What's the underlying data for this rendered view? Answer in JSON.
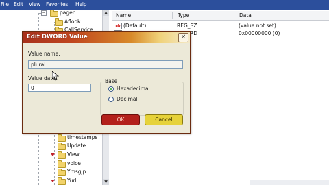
{
  "menubar": {
    "items": [
      "File",
      "Edit",
      "View",
      "Favorites",
      "Help"
    ]
  },
  "tree": {
    "items_top": [
      "pager",
      "Aflook",
      "CallService"
    ],
    "items_bottom": [
      "timestamps",
      "Update",
      "View",
      "voice",
      "Ymsgjp",
      "Yurl"
    ]
  },
  "list": {
    "headers": {
      "name": "Name",
      "type": "Type",
      "data": "Data"
    },
    "rows": [
      {
        "icon": "ab",
        "name": "(Default)",
        "type": "REG_SZ",
        "data": "(value not set)"
      },
      {
        "icon": "dword",
        "name": "",
        "type": "DWORD",
        "data": "0x00000000 (0)"
      }
    ]
  },
  "dialog": {
    "title": "Edit DWORD Value",
    "close_symbol": "×",
    "value_name_label": "Value name:",
    "value_name": "plural",
    "value_data_label": "Value data:",
    "value_data": "0",
    "base_label": "Base",
    "radio_hex": "Hexadecimal",
    "radio_dec": "Decimal",
    "selected_base": "Hexadecimal",
    "ok_label": "OK",
    "cancel_label": "Cancel",
    "colors": {
      "title_start": "#a8311d",
      "title_end": "#f4e9c8",
      "ok": "#b3201b",
      "cancel": "#e6d23a"
    }
  }
}
